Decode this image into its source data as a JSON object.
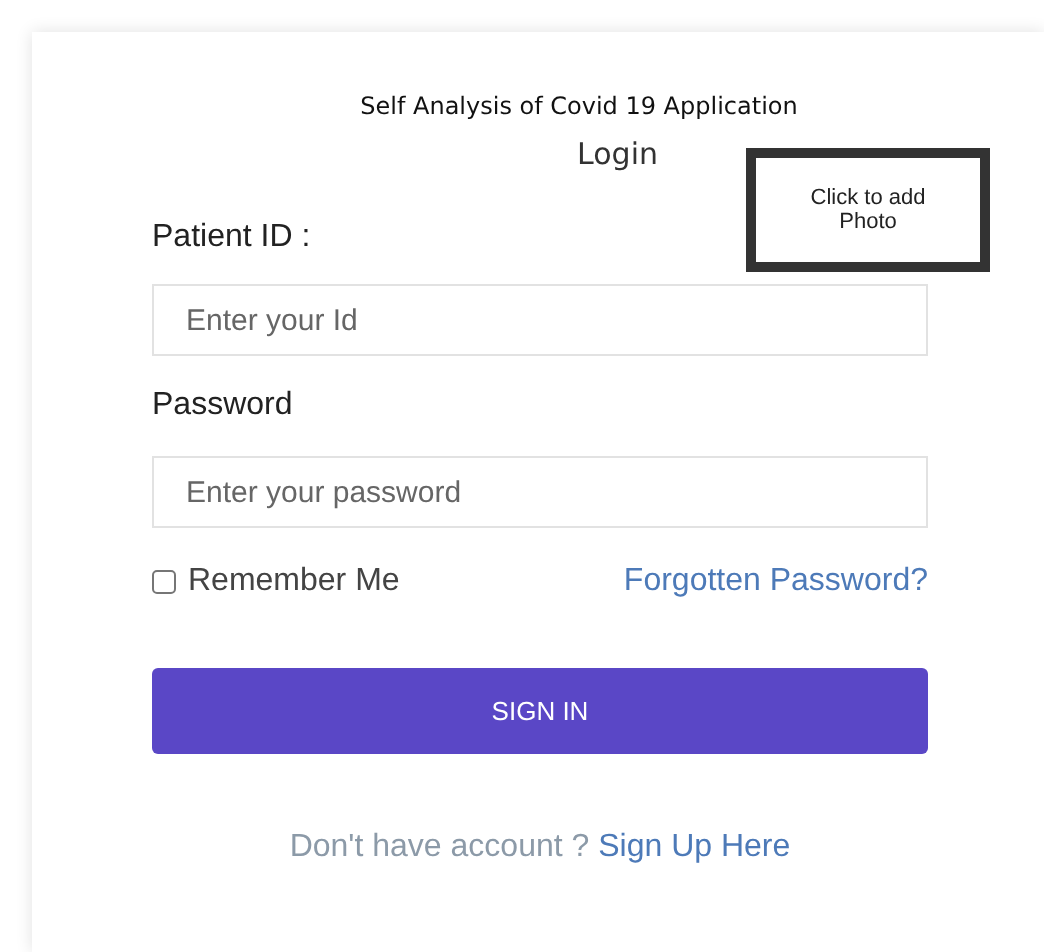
{
  "app_title": "Self Analysis of Covid 19 Application",
  "heading": "Login",
  "photo_box": {
    "label": "Click to add Photo"
  },
  "fields": [
    {
      "label": "Patient ID :",
      "placeholder": "Enter your Id"
    },
    {
      "label": "Password",
      "placeholder": "Enter your password"
    }
  ],
  "remember": {
    "label": "Remember Me",
    "checked": false
  },
  "forgot_link": "Forgotten Password?",
  "submit": "SIGN IN",
  "signup": {
    "prompt": "Don't have account ?",
    "link": "Sign Up Here"
  }
}
